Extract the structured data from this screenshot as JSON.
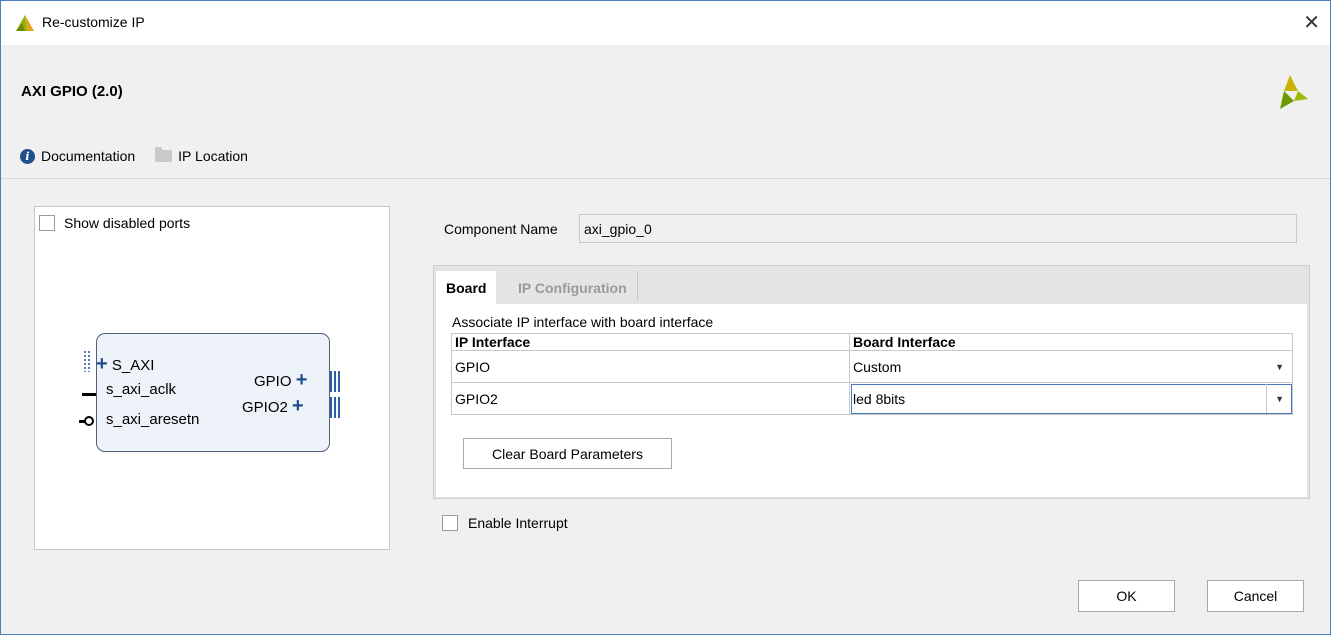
{
  "window": {
    "title": "Re-customize IP",
    "close_glyph": "✕"
  },
  "header": {
    "ip_title": "AXI GPIO (2.0)",
    "documentation_label": "Documentation",
    "ip_location_label": "IP Location",
    "brand_icon": "xilinx-logo-icon"
  },
  "symbol": {
    "show_disabled_label": "Show disabled ports",
    "show_disabled_checked": false,
    "ports_left": [
      "S_AXI",
      "s_axi_aclk",
      "s_axi_aresetn"
    ],
    "ports_right": [
      "GPIO",
      "GPIO2"
    ]
  },
  "component": {
    "label": "Component Name",
    "value": "axi_gpio_0"
  },
  "tabs": [
    {
      "label": "Board",
      "active": true
    },
    {
      "label": "IP Configuration",
      "active": false
    }
  ],
  "board": {
    "description": "Associate IP interface with board interface",
    "columns": [
      "IP Interface",
      "Board Interface"
    ],
    "rows": [
      {
        "ip": "GPIO",
        "board": "Custom"
      },
      {
        "ip": "GPIO2",
        "board": "led 8bits"
      }
    ],
    "clear_button": "Clear Board Parameters"
  },
  "interrupt": {
    "label": "Enable Interrupt",
    "checked": false
  },
  "footer": {
    "ok": "OK",
    "cancel": "Cancel"
  },
  "colors": {
    "accent": "#1f4e8c",
    "block_fill": "#eef2f9",
    "window_border": "#4a7fc1"
  }
}
